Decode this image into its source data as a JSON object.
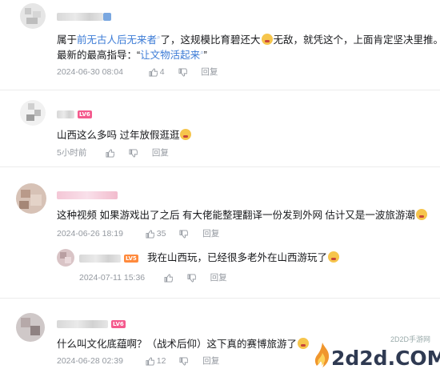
{
  "comments": [
    {
      "text_pre": "属于",
      "link1": "前无古人后无来者",
      "text_mid": "了，这规模比育碧还大",
      "text_post": "无敌，就凭这个，上面肯定坚决里推。",
      "line2_pre": "最新的最高指导：“",
      "link2": "让文物活起来",
      "line2_post": "”",
      "date": "2024-06-30 08:04",
      "likes": "4",
      "reply": "回复"
    },
    {
      "text": "山西这么多吗 过年放假逛逛",
      "date": "5小时前",
      "reply": "回复"
    },
    {
      "text": "这种视频 如果游戏出了之后 有大佬能整理翻译一份发到外网 估计又是一波旅游潮",
      "date": "2024-06-26 18:19",
      "likes": "35",
      "reply": "回复",
      "sub": {
        "level": "LV5",
        "text": "我在山西玩，已经很多老外在山西游玩了",
        "date": "2024-07-11 15:36",
        "reply": "回复"
      }
    },
    {
      "text": "什么叫文化底蕴啊？（战术后仰）这下真的赛博旅游了",
      "date": "2024-06-28 02:39",
      "likes": "12",
      "reply": "回复"
    }
  ],
  "levels": [
    "LV5",
    "LV6"
  ],
  "watermark": {
    "main": "2d2d.COM",
    "sub": "2D2D手游网"
  },
  "colors": {
    "link": "#3b7bd6",
    "level_pink": "#f45a8d",
    "level_orange": "#ff8a3d",
    "meta": "#9499a0"
  }
}
